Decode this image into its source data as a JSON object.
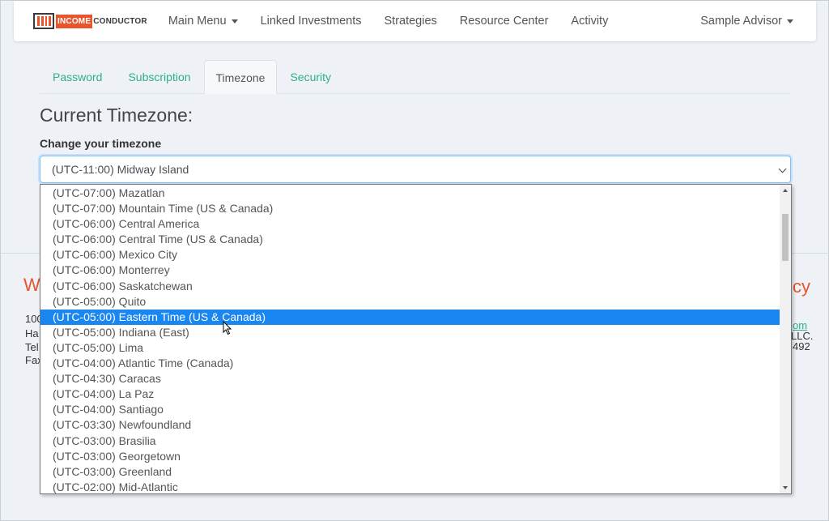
{
  "navbar": {
    "logo_income": "INCOME",
    "logo_conductor": "CONDUCTOR",
    "items": [
      {
        "label": "Main Menu",
        "has_caret": true
      },
      {
        "label": "Linked Investments"
      },
      {
        "label": "Strategies"
      },
      {
        "label": "Resource Center"
      },
      {
        "label": "Activity"
      }
    ],
    "user": "Sample Advisor"
  },
  "tabs": [
    {
      "label": "Password"
    },
    {
      "label": "Subscription"
    },
    {
      "label": "Timezone",
      "active": true
    },
    {
      "label": "Security"
    }
  ],
  "page_title": "Current Timezone:",
  "field_label": "Change your timezone",
  "select": {
    "value": "(UTC-11:00) Midway Island"
  },
  "dropdown": {
    "options": [
      "(UTC-07:00) Mazatlan",
      "(UTC-07:00) Mountain Time (US & Canada)",
      "(UTC-06:00) Central America",
      "(UTC-06:00) Central Time (US & Canada)",
      "(UTC-06:00) Mexico City",
      "(UTC-06:00) Monterrey",
      "(UTC-06:00) Saskatchewan",
      "(UTC-05:00) Quito",
      "(UTC-05:00) Eastern Time (US & Canada)",
      "(UTC-05:00) Indiana (East)",
      "(UTC-05:00) Lima",
      "(UTC-04:00) Atlantic Time (Canada)",
      "(UTC-04:30) Caracas",
      "(UTC-04:00) La Paz",
      "(UTC-04:00) Santiago",
      "(UTC-03:30) Newfoundland",
      "(UTC-03:00) Brasilia",
      "(UTC-03:00) Georgetown",
      "(UTC-03:00) Greenland",
      "(UTC-02:00) Mid-Atlantic"
    ],
    "highlighted_index": 8
  },
  "background_fragments": {
    "left_heading": "W",
    "left_lines": [
      "100",
      "Ha",
      "Tel",
      "Fax"
    ],
    "right_heading": "cy",
    "right_link": "om",
    "right_lines": [
      "LLC.",
      "492"
    ]
  },
  "colors": {
    "accent_green": "#2fae8a",
    "brand_orange": "#e8542c",
    "selection_blue": "#1a86f0"
  }
}
